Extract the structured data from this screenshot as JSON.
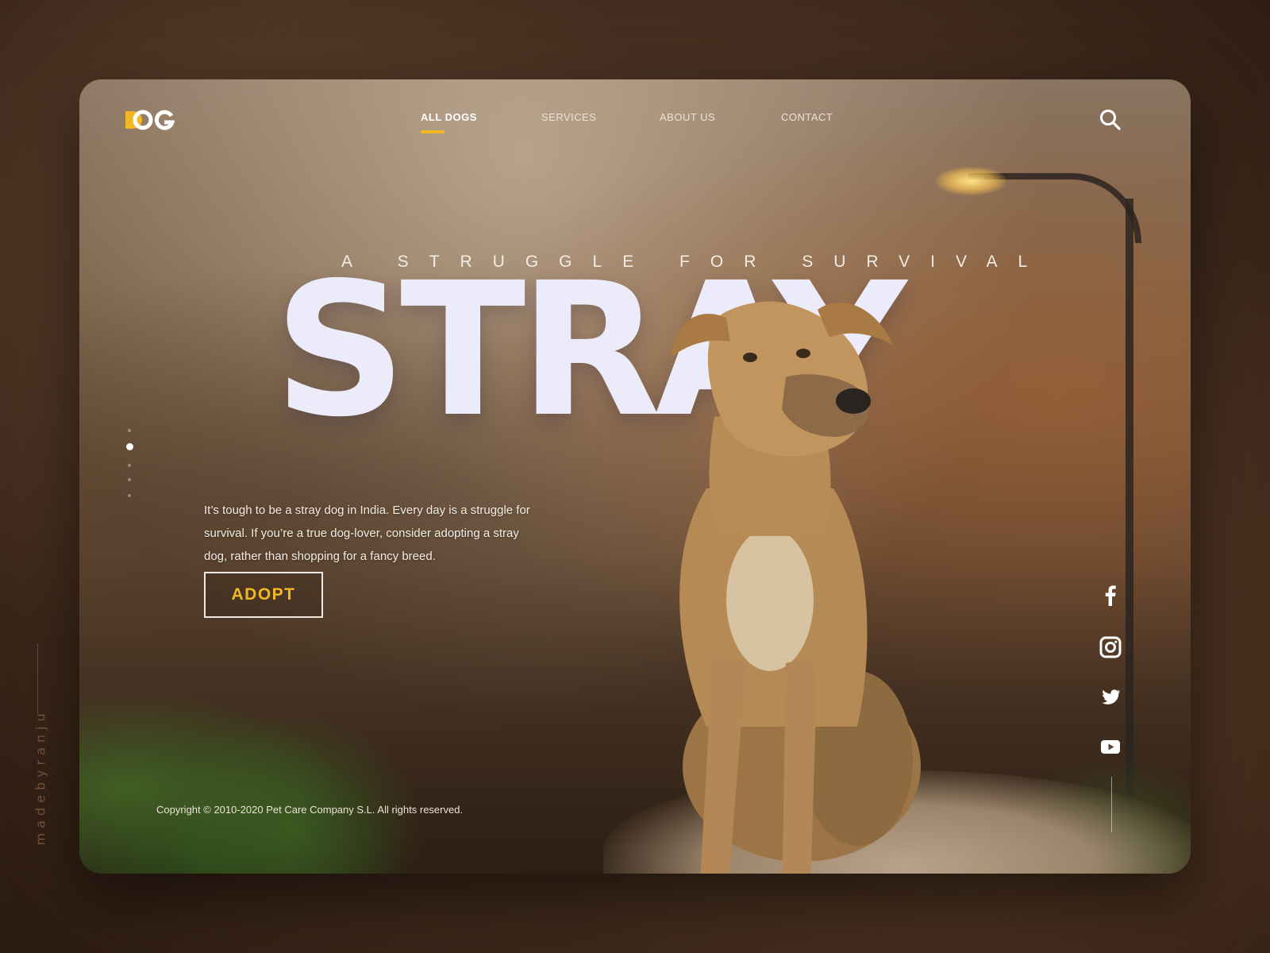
{
  "side_credit": "madebyranju",
  "logo": {
    "text": "DOG",
    "accent_color": "#f2b824"
  },
  "nav": {
    "items": [
      {
        "label": "ALL DOGS",
        "active": true
      },
      {
        "label": "SERVICES",
        "active": false
      },
      {
        "label": "ABOUT US",
        "active": false
      },
      {
        "label": "CONTACT",
        "active": false
      }
    ]
  },
  "header": {
    "search_icon": "search-icon"
  },
  "hero": {
    "tagline": "A STRUGGLE FOR SURVIVAL",
    "title": "STRAY",
    "description": "It’s tough to be a stray dog in India. Every day is a struggle for survival. If you’re a true dog-lover, consider adopting a stray dog, rather than shopping for a fancy breed.",
    "cta_label": "ADOPT"
  },
  "slider": {
    "count": 5,
    "active_index": 1
  },
  "social": [
    {
      "icon": "facebook-icon"
    },
    {
      "icon": "instagram-icon"
    },
    {
      "icon": "twitter-icon"
    },
    {
      "icon": "youtube-icon"
    }
  ],
  "footer": {
    "copyright": "Copyright © 2010-2020  Pet Care Company S.L. All rights reserved."
  },
  "colors": {
    "accent": "#f2b824",
    "title": "#ecebfa"
  }
}
